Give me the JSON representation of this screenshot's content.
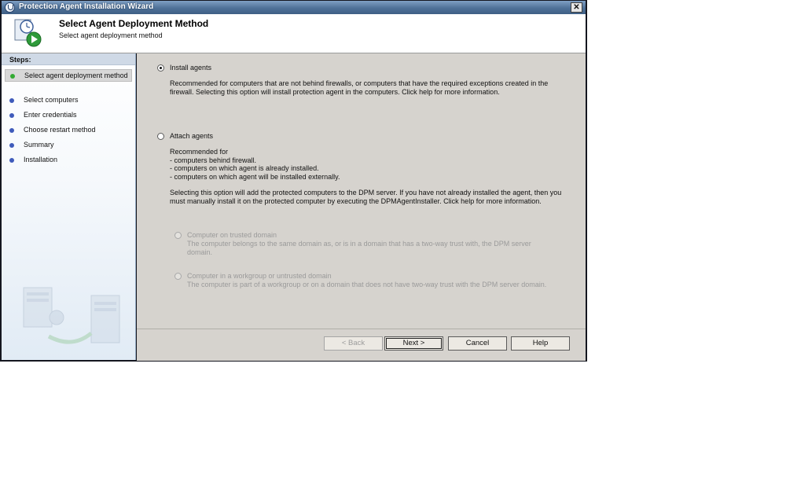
{
  "window": {
    "title": "Protection Agent Installation Wizard",
    "close_glyph": "✕"
  },
  "header": {
    "title": "Select Agent Deployment Method",
    "subtitle": "Select agent deployment method",
    "icon": "wizard-clock-play-icon"
  },
  "sidebar": {
    "steps_label": "Steps:",
    "steps": [
      {
        "label": "Select agent deployment method",
        "active": true
      },
      {
        "label": "Select computers"
      },
      {
        "label": "Enter credentials"
      },
      {
        "label": "Choose restart method"
      },
      {
        "label": "Summary"
      },
      {
        "label": "Installation"
      }
    ]
  },
  "main": {
    "install": {
      "label": "Install agents",
      "selected": true,
      "description": "Recommended for computers that are not behind firewalls, or computers that have the required exceptions created in the firewall. Selecting this option will install protection agent in the computers. Click help for more information."
    },
    "attach": {
      "label": "Attach agents",
      "selected": false,
      "rec_intro": "Recommended for",
      "rec_items": [
        "- computers behind firewall.",
        "- computers on which agent is already installed.",
        "- computers on which agent will be installed externally."
      ],
      "description": "Selecting this option will add the protected computers to the DPM server. If you have not already installed the agent, then you must manually install it on the protected computer by executing the DPMAgentInstaller. Click help for more information."
    },
    "trusted": {
      "label": "Computer on trusted domain",
      "description": "The computer belongs to the same domain as, or is in a domain that has a two-way trust with, the DPM server domain."
    },
    "workgroup": {
      "label": "Computer in a workgroup or untrusted domain",
      "description": "The computer is part of a workgroup or on a domain that does not have two-way trust with the DPM server domain."
    }
  },
  "footer": {
    "back": "< Back",
    "next": "Next >",
    "cancel": "Cancel",
    "help": "Help"
  },
  "colors": {
    "title_bar": "#4f7198",
    "content_bg": "#d6d3ce",
    "step_bullet": "#3f5bbb",
    "active_step_bullet": "#33aa33"
  }
}
